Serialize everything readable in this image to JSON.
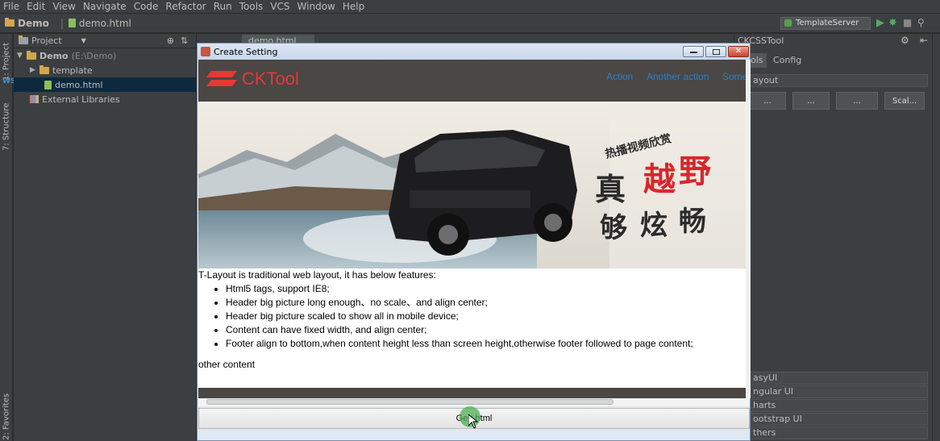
{
  "menu": [
    "File",
    "Edit",
    "View",
    "Navigate",
    "Code",
    "Refactor",
    "Run",
    "Tools",
    "VCS",
    "Window",
    "Help"
  ],
  "navbar": {
    "project": "Demo",
    "file": "demo.html",
    "run_config": "TemplateServer"
  },
  "left_strip": {
    "project_tab": "1: Project",
    "structure_tab": "7: Structure",
    "favorites_tab": "2: Favorites"
  },
  "project_panel": {
    "header": "Project",
    "tree": [
      {
        "label": "Demo",
        "suffix": "(E:\\Demo)"
      },
      {
        "label": "template"
      },
      {
        "label": "demo.html"
      },
      {
        "label": "External Libraries"
      }
    ]
  },
  "editor_tab": "demo.html",
  "right_panel": {
    "title": "CKCSSTool",
    "tabs": [
      "ols",
      "Config"
    ],
    "layout_label": "ayout",
    "buttons": [
      "...",
      "...",
      "...",
      "Scal..."
    ],
    "accordion": [
      "asyUI",
      "ngular UI",
      "harts",
      "ootstrap UI",
      "thers"
    ]
  },
  "dialog": {
    "title": "Create Setting",
    "brand": "CKTool",
    "nav": [
      "Action",
      "Another action",
      "Some"
    ],
    "intro": "T-Layout is traditional web layout, it has below features:",
    "features": [
      "Html5 tags, support IE8;",
      "Header big picture long enough、no scale、and align center;",
      "Header big picture scaled to show all in mobile device;",
      "Content can have fixed width, and align center;",
      "Footer align to bottom,when content height less than screen height,otherwise footer followed to page content;"
    ],
    "other": "other content",
    "gen_button": "Gen html"
  },
  "colors": {
    "accent": "#e53935",
    "link": "#2a7fc9",
    "dark_header": "#4a4745"
  }
}
